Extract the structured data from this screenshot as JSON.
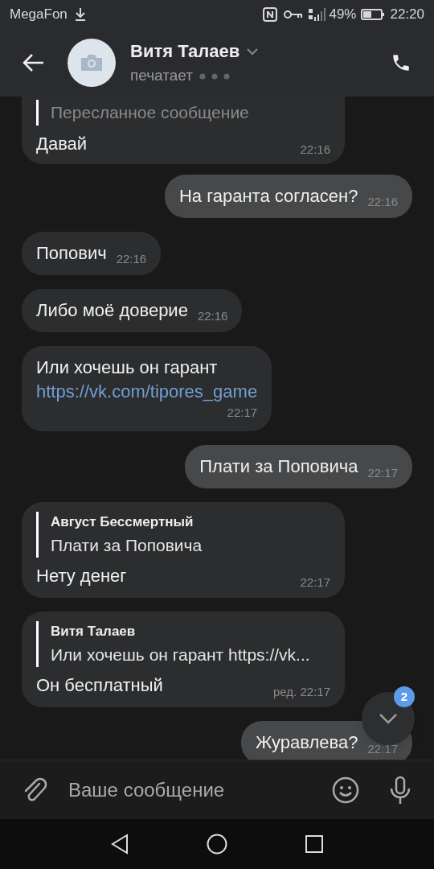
{
  "status_bar": {
    "carrier": "MegaFon",
    "battery_percent": "49%",
    "time": "22:20"
  },
  "header": {
    "name": "Витя Талаев",
    "status": "печатает"
  },
  "messages": [
    {
      "outgoing": false,
      "quote": {
        "text": "Пересланное сообщение"
      },
      "text": "Давай",
      "time": "22:16",
      "cut_top": true
    },
    {
      "outgoing": true,
      "text": "На гаранта согласен?",
      "time": "22:16"
    },
    {
      "outgoing": false,
      "text": "Попович",
      "time": "22:16"
    },
    {
      "outgoing": false,
      "text": "Либо моё доверие",
      "time": "22:16"
    },
    {
      "outgoing": false,
      "text": "Или хочешь он гарант",
      "link": "https://vk.com/tipores_game",
      "time": "22:17"
    },
    {
      "outgoing": true,
      "text": "Плати за Поповича",
      "time": "22:17"
    },
    {
      "outgoing": false,
      "quote": {
        "author": "Август Бессмертный",
        "text": "Плати за Поповича"
      },
      "text": "Нету денег",
      "time": "22:17"
    },
    {
      "outgoing": false,
      "quote": {
        "author": "Витя Талаев",
        "text": "Или хочешь он гарант https://vk..."
      },
      "text": "Он бесплатный",
      "time": "ред. 22:17"
    },
    {
      "outgoing": true,
      "text": "Журавлева?",
      "time": "22:17"
    }
  ],
  "scroll_button": {
    "badge": "2"
  },
  "composer": {
    "placeholder": "Ваше сообщение"
  }
}
